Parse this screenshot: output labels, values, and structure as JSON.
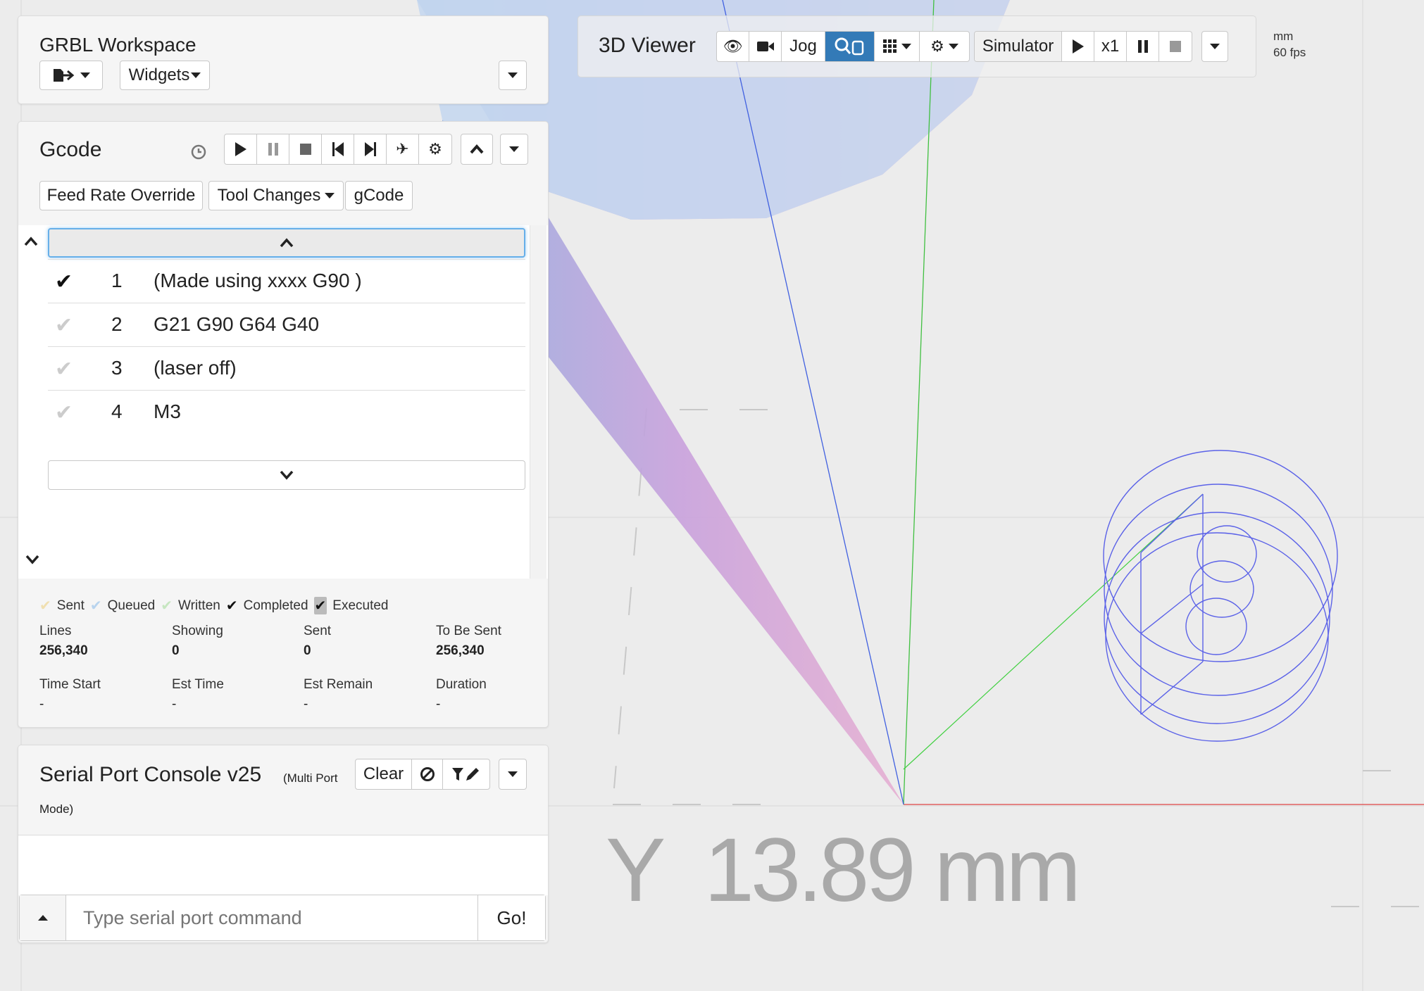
{
  "workspace": {
    "title": "GRBL Workspace",
    "widgets_label": "Widgets"
  },
  "gcode": {
    "title": "Gcode",
    "feed_rate_label": "Feed Rate Override",
    "tool_changes_label": "Tool Changes",
    "gcode_tab_label": "gCode",
    "lines": [
      {
        "num": "1",
        "code": "(Made using xxxx G90 )",
        "done": true
      },
      {
        "num": "2",
        "code": "G21 G90 G64 G40",
        "done": false
      },
      {
        "num": "3",
        "code": "(laser off)",
        "done": false
      },
      {
        "num": "4",
        "code": "M3",
        "done": false
      }
    ],
    "legend": {
      "sent": "Sent",
      "queued": "Queued",
      "written": "Written",
      "completed": "Completed",
      "executed": "Executed"
    },
    "stats": {
      "lines_label": "Lines",
      "lines_value": "256,340",
      "showing_label": "Showing",
      "showing_value": "0",
      "sent_label": "Sent",
      "sent_value": "0",
      "tobesent_label": "To Be Sent",
      "tobesent_value": "256,340",
      "time_start_label": "Time Start",
      "time_start_value": "-",
      "est_time_label": "Est Time",
      "est_time_value": "-",
      "est_remain_label": "Est Remain",
      "est_remain_value": "-",
      "duration_label": "Duration",
      "duration_value": "-"
    }
  },
  "serial": {
    "title": "Serial Port Console v25",
    "subtitle_1": "(Multi Port",
    "subtitle_2": "Mode)",
    "clear_label": "Clear",
    "input_placeholder": "Type serial port command",
    "go_label": "Go!"
  },
  "viewer": {
    "title": "3D Viewer",
    "jog_label": "Jog",
    "simulator_label": "Simulator",
    "speed_label": "x1",
    "units_label": "mm",
    "fps_label": "60 fps",
    "readout": "Y  13.89 mm"
  },
  "colors": {
    "accent": "#337ab7",
    "completed": "#111111",
    "pending_check": "#cccccc",
    "sent": "#f0dfb0",
    "queued": "#b8d4ee",
    "written": "#c6e6c0"
  },
  "icons": [
    "file-export-icon",
    "chevron-down-icon",
    "history-icon",
    "play-icon",
    "pause-icon",
    "stop-icon",
    "step-back-icon",
    "step-forward-icon",
    "plane-icon",
    "gear-icon",
    "chevron-up-icon",
    "check-icon",
    "ban-icon",
    "filter-edit-icon",
    "eye-icon",
    "video-camera-icon",
    "search-pointer-icon",
    "grid-icon"
  ]
}
